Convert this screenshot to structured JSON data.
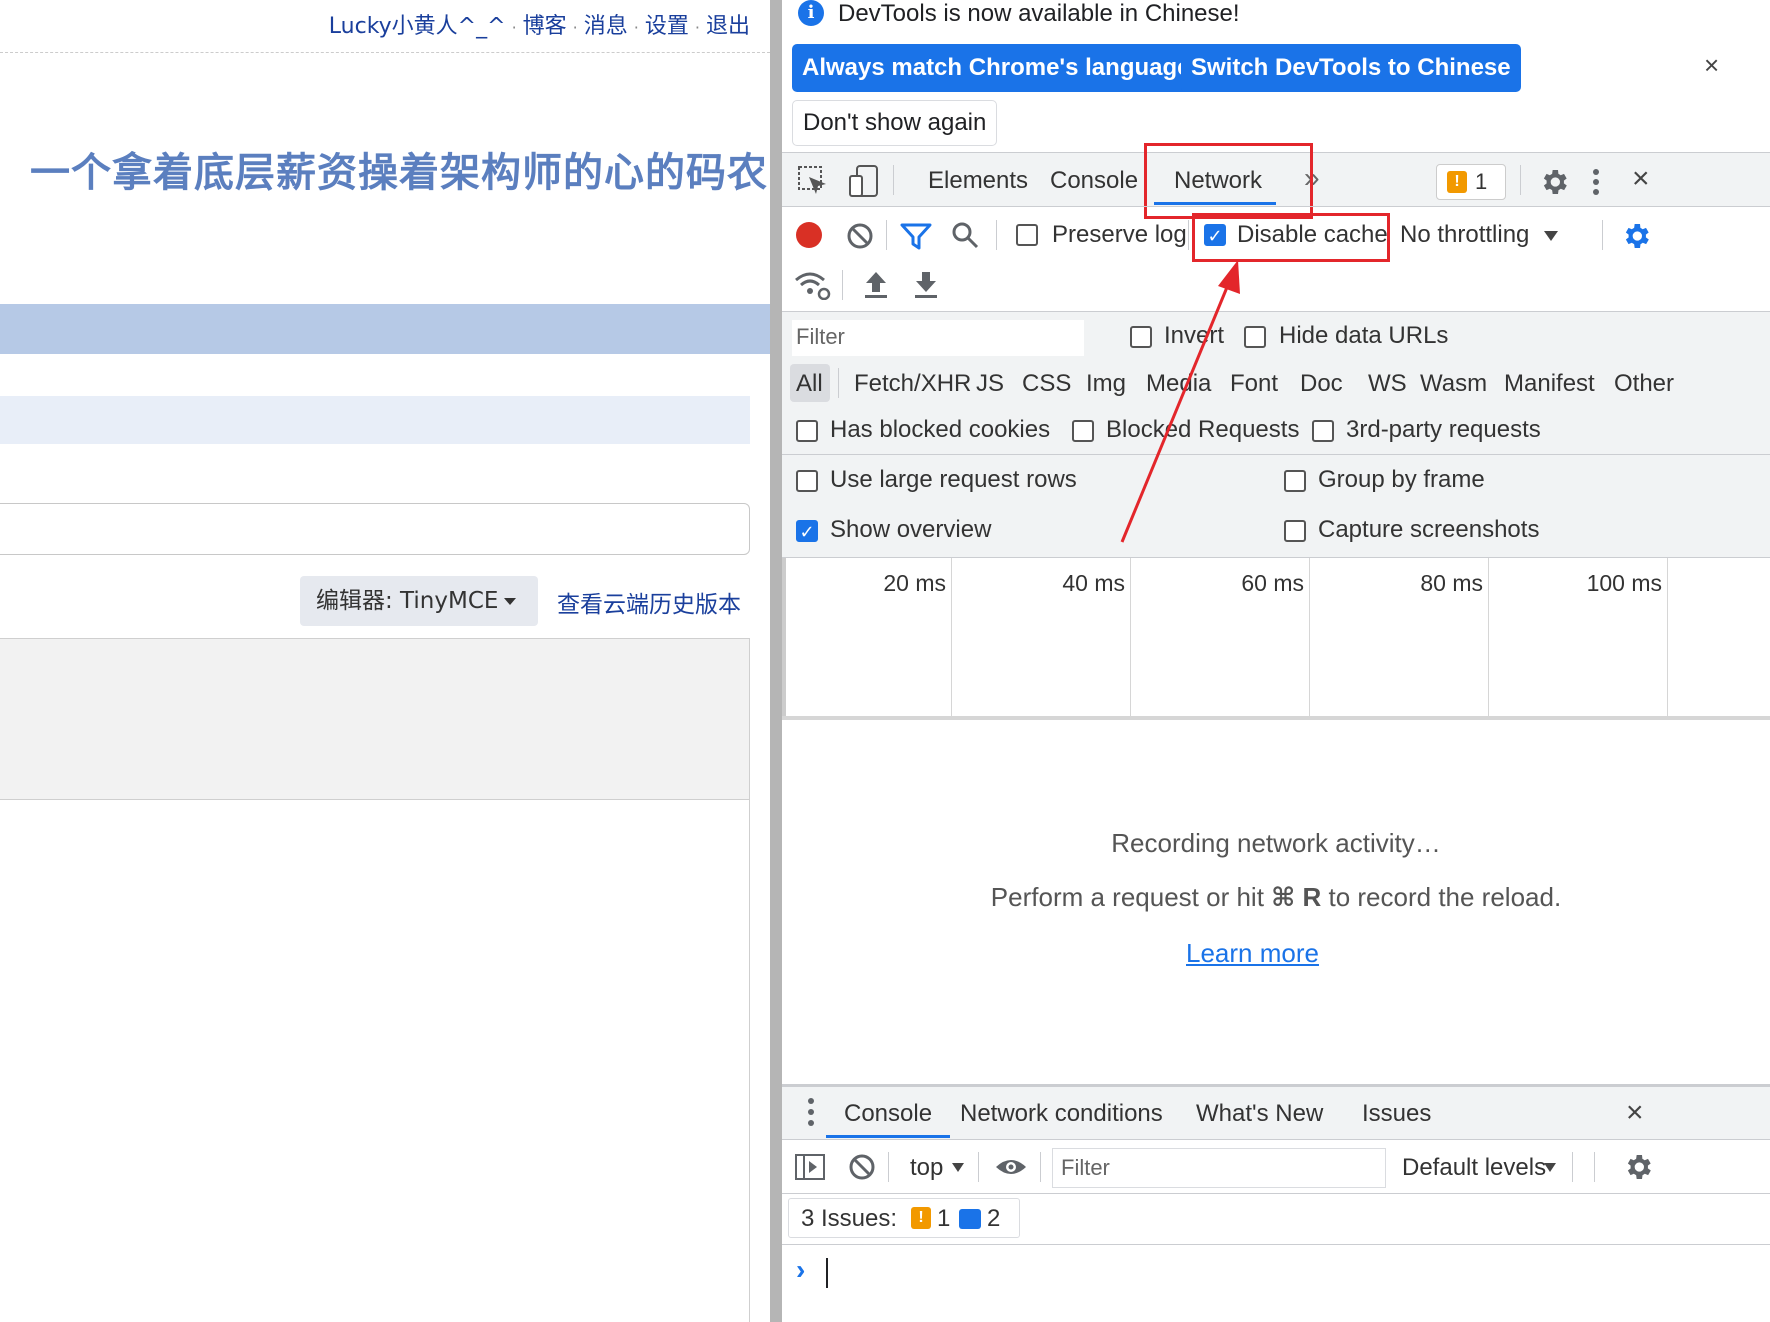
{
  "page": {
    "nav_links": [
      "Lucky小黄人^_^",
      "博客",
      "消息",
      "设置",
      "退出"
    ],
    "blog_title": "一个拿着底层薪资操着架构师的心的码农",
    "editor_selector": "编辑器: TinyMCE",
    "history_link": "查看云端历史版本"
  },
  "devtools": {
    "banner_text": "DevTools is now available in Chinese!",
    "match_language_button": "Always match Chrome's language",
    "switch_chinese_button": "Switch DevTools to Chinese",
    "dont_show_button": "Don't show again",
    "close_symbol": "×",
    "tabs": [
      "Elements",
      "Console",
      "Network"
    ],
    "active_tab": "Network",
    "more_tabs_symbol": "»",
    "issues_count": "1",
    "network_toolbar": {
      "preserve_log": "Preserve log",
      "disable_cache": "Disable cache",
      "disable_cache_checked": true,
      "throttling": "No throttling"
    },
    "filter": {
      "placeholder": "Filter",
      "invert": "Invert",
      "hide_data_urls": "Hide data URLs",
      "types": [
        "All",
        "Fetch/XHR",
        "JS",
        "CSS",
        "Img",
        "Media",
        "Font",
        "Doc",
        "WS",
        "Wasm",
        "Manifest",
        "Other"
      ],
      "active_type": "All",
      "has_blocked_cookies": "Has blocked cookies",
      "blocked_requests": "Blocked Requests",
      "third_party": "3rd-party requests"
    },
    "settings": {
      "large_rows": "Use large request rows",
      "group_by_frame": "Group by frame",
      "show_overview": "Show overview",
      "show_overview_checked": true,
      "capture_screenshots": "Capture screenshots"
    },
    "timeline_ticks": [
      "20 ms",
      "40 ms",
      "60 ms",
      "80 ms",
      "100 ms"
    ],
    "empty_state": {
      "title": "Recording network activity…",
      "hint_before": "Perform a request or hit ",
      "hint_key": "⌘ R",
      "hint_after": " to record the reload.",
      "learn_more": "Learn more"
    },
    "drawer": {
      "tabs": [
        "Console",
        "Network conditions",
        "What's New",
        "Issues"
      ],
      "active_tab": "Console",
      "context": "top",
      "filter_placeholder": "Filter",
      "levels": "Default levels",
      "issues_label": "3 Issues:",
      "issues_warn": "1",
      "issues_info": "2",
      "prompt": "›"
    },
    "colors": {
      "accent": "#1a73e8",
      "highlight": "#e3262b",
      "record": "#d93025",
      "warning": "#f29900"
    }
  }
}
